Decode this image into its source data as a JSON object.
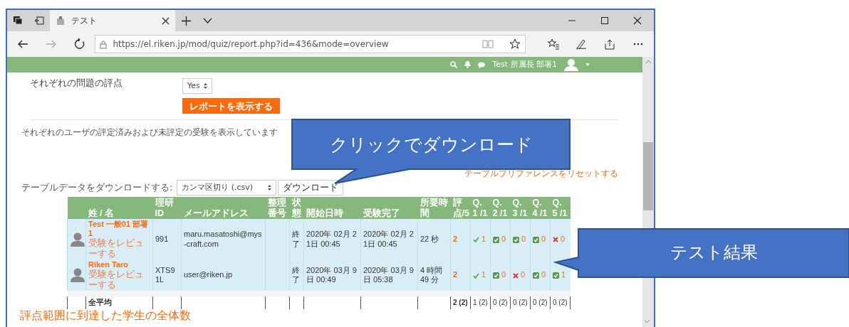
{
  "browser": {
    "tab_title": "テスト",
    "url": "https://el.riken.jp/mod/quiz/report.php?id=436&mode=overview"
  },
  "navbar": {
    "user_name": "Test 所属長 部署1"
  },
  "form": {
    "label": "それぞれの問題の評点",
    "select_value": "Yes",
    "button": "レポートを表示する"
  },
  "info_text": "それぞれのユーザの評定済みおよび未評定の受験を表示しています",
  "reset_link": "テーブルプリファレンスをリセットする",
  "download": {
    "label": "テーブルデータをダウンロードする:",
    "format": "カンマ区切り (.csv)",
    "button": "ダウンロード"
  },
  "table": {
    "columns": [
      "姓 / 名",
      "理研ID",
      "メールアドレス",
      "整理番号",
      "状態",
      "開始日時",
      "受験完了",
      "所要時間",
      "評点/5",
      "Q. 1 /1",
      "Q. 2 /1",
      "Q. 3 /1",
      "Q. 4 /1",
      "Q. 5 /1"
    ],
    "rows": [
      {
        "name": "Test 一般01 部署1",
        "review_link": "受験をレビューする",
        "id": "991",
        "email": "maru.masatoshi@mys-craft.com",
        "status": "終了",
        "start": "2020年 02月 21日 00:45",
        "end": "2020年 02月 21日 00:45",
        "duration": "22 秒",
        "grade": "2",
        "questions": [
          {
            "kind": "check",
            "score": "1"
          },
          {
            "kind": "box",
            "score": "0"
          },
          {
            "kind": "box",
            "score": "0"
          },
          {
            "kind": "box",
            "score": "0"
          },
          {
            "kind": "cross",
            "score": "0"
          }
        ]
      },
      {
        "name": "Riken Taro",
        "review_link": "受験をレビューする",
        "id": "XTS91L",
        "email": "user@riken.jp",
        "status": "終了",
        "start": "2020年 03月 9日 00:49",
        "end": "2020年 03月 9日 05:38",
        "duration": "4 時間 49 分",
        "grade": "2",
        "questions": [
          {
            "kind": "check",
            "score": "1"
          },
          {
            "kind": "box",
            "score": "0"
          },
          {
            "kind": "cross",
            "score": "0"
          },
          {
            "kind": "box",
            "score": "0"
          },
          {
            "kind": "box",
            "score": "1"
          }
        ]
      }
    ],
    "average": {
      "label": "全平均",
      "grade": "2 (2)",
      "questions": [
        "1 (2)",
        "0 (2)",
        "0 (2)",
        "0 (2)",
        "0 (2)"
      ]
    }
  },
  "summary_heading": "評点範囲に到達した学生の全体数",
  "callouts": [
    {
      "text": "クリックでダウンロード"
    },
    {
      "text": "テスト結果"
    }
  ]
}
